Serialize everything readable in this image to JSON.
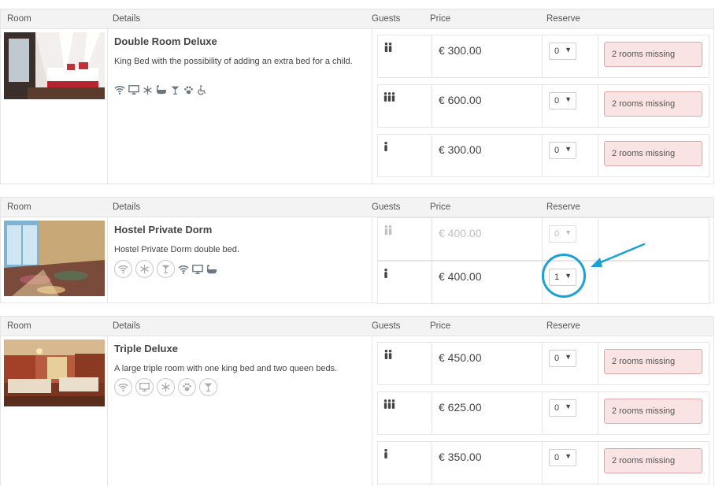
{
  "headers": {
    "room": "Room",
    "details": "Details",
    "guests": "Guests",
    "price": "Price",
    "reserve": "Reserve"
  },
  "rooms": [
    {
      "title": "Double Room Deluxe",
      "description": "King Bed with the possibility of adding an extra bed for a child.",
      "amenities": [
        "wifi-icon",
        "tv-icon",
        "snowflake-icon",
        "bathtub-icon",
        "cocktail-icon",
        "paw-icon",
        "wheelchair-icon"
      ],
      "rates": [
        {
          "guests_icon": "two-persons-icon",
          "price": "€ 300.00",
          "qty": "0",
          "status": "2 rooms missing"
        },
        {
          "guests_icon": "three-persons-icon",
          "price": "€ 600.00",
          "qty": "0",
          "status": "2 rooms missing"
        },
        {
          "guests_icon": "one-person-icon",
          "price": "€ 300.00",
          "qty": "0",
          "status": "2 rooms missing"
        }
      ]
    },
    {
      "title": "Hostel Private Dorm",
      "description": "Hostel Private Dorm double bed.",
      "amenities": [
        "wifi-circle-icon",
        "snowflake-circle-icon",
        "cocktail-circle-icon",
        "wifi-icon",
        "tv-icon",
        "bathtub-icon"
      ],
      "rates": [
        {
          "guests_icon": "two-persons-icon",
          "price": "€ 400.00",
          "qty": "0",
          "status": ""
        },
        {
          "guests_icon": "one-person-icon",
          "price": "€ 400.00",
          "qty": "1",
          "status": ""
        }
      ]
    },
    {
      "title": "Triple Deluxe",
      "description": "A large triple room with one king bed and two queen beds.",
      "amenities": [
        "wifi-circle-icon",
        "tv-circle-icon",
        "snowflake-circle-icon",
        "paw-circle-icon",
        "cocktail-circle-icon"
      ],
      "rates": [
        {
          "guests_icon": "two-persons-icon",
          "price": "€ 450.00",
          "qty": "0",
          "status": "2 rooms missing"
        },
        {
          "guests_icon": "three-persons-icon",
          "price": "€ 625.00",
          "qty": "0",
          "status": "2 rooms missing"
        },
        {
          "guests_icon": "one-person-icon",
          "price": "€ 350.00",
          "qty": "0",
          "status": "2 rooms missing"
        }
      ]
    }
  ],
  "colors": {
    "annotation": "#1ba1d6",
    "missing_bg": "#f9e3e3",
    "missing_border": "#e0a8a8"
  }
}
